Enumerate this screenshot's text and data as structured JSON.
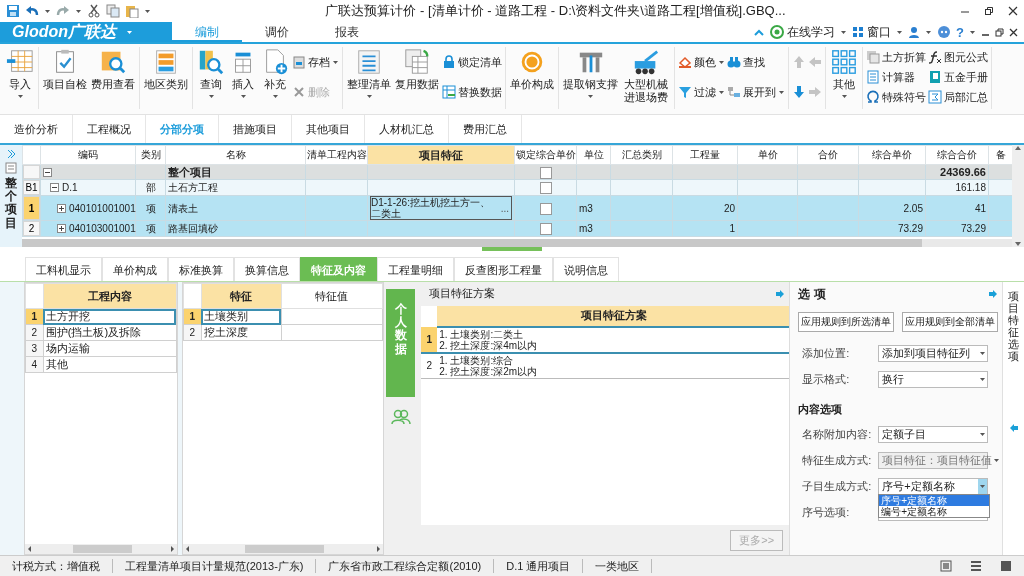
{
  "window": {
    "title": "广联达预算计价 - [清单计价 - 道路工程 - D:\\资料文件夹\\道路工程[增值税].GBQ..."
  },
  "menu": {
    "logo": "Glodon广联达",
    "tabs": [
      {
        "label": "编制",
        "selected": true
      },
      {
        "label": "调价",
        "selected": false
      },
      {
        "label": "报表",
        "selected": false
      }
    ],
    "links": [
      "在线学习",
      "窗口"
    ],
    "help": "?"
  },
  "ribbon": {
    "groups": [
      {
        "columns": [
          [
            {
              "label": "导入",
              "kind": "large",
              "dropdown": true
            }
          ]
        ]
      },
      {
        "columns": [
          [
            {
              "label": "项目自检",
              "kind": "large",
              "dropdown": false
            }
          ],
          [
            {
              "label": "费用查看",
              "kind": "large",
              "dropdown": false
            }
          ]
        ]
      },
      {
        "columns": [
          [
            {
              "label": "地区类别",
              "kind": "large",
              "dropdown": false
            }
          ]
        ]
      },
      {
        "columns": [
          [
            {
              "label": "查询",
              "kind": "large",
              "dropdown": true
            }
          ],
          [
            {
              "label": "插入",
              "kind": "large",
              "dropdown": true
            }
          ],
          [
            {
              "label": "补充",
              "kind": "large",
              "dropdown": true
            }
          ],
          [
            {
              "label": "存档",
              "kind": "small",
              "dropdown": true,
              "disabled": false
            },
            {
              "label": "删除",
              "kind": "small",
              "dropdown": false,
              "disabled": true
            }
          ]
        ]
      },
      {
        "columns": [
          [
            {
              "label": "整理清单",
              "kind": "large",
              "dropdown": true
            }
          ],
          [
            {
              "label": "复用数据",
              "kind": "large",
              "dropdown": false
            }
          ],
          [
            {
              "label": "锁定清单",
              "kind": "small",
              "dropdown": false,
              "disabled": false
            },
            {
              "label": "替换数据",
              "kind": "small",
              "dropdown": false,
              "disabled": false
            }
          ]
        ]
      },
      {
        "columns": [
          [
            {
              "label": "单价构成",
              "kind": "large",
              "dropdown": false
            }
          ]
        ]
      },
      {
        "columns": [
          [
            {
              "label": "提取钢支撑",
              "kind": "large",
              "dropdown": true
            }
          ],
          [
            {
              "label": "大型机械进退场费",
              "kind": "large",
              "dropdown": false
            }
          ]
        ]
      },
      {
        "columns": [
          [
            {
              "label": "颜色",
              "kind": "small",
              "dropdown": true,
              "disabled": false
            },
            {
              "label": "过滤",
              "kind": "small",
              "dropdown": true,
              "disabled": false
            }
          ],
          [
            {
              "label": "查找",
              "kind": "small",
              "dropdown": false,
              "disabled": false
            },
            {
              "label": "展开到",
              "kind": "small",
              "dropdown": true,
              "disabled": false
            }
          ]
        ]
      },
      {
        "columns": [
          [
            {
              "kind": "arrow",
              "disabled": true
            },
            {
              "kind": "arrow",
              "disabled": false
            }
          ],
          [
            {
              "kind": "arrow",
              "disabled": true
            },
            {
              "kind": "arrow",
              "disabled": true
            }
          ]
        ]
      },
      {
        "columns": [
          [
            {
              "label": "其他",
              "kind": "large",
              "dropdown": true
            }
          ]
        ]
      },
      {
        "columns": [
          [
            {
              "label": "土方折算",
              "kind": "small",
              "dropdown": false,
              "disabled": false
            },
            {
              "label": "计算器",
              "kind": "small",
              "dropdown": false,
              "disabled": false
            },
            {
              "label": "特殊符号",
              "kind": "small",
              "dropdown": false,
              "disabled": false
            }
          ],
          [
            {
              "label": "图元公式",
              "kind": "small",
              "dropdown": false,
              "disabled": false
            },
            {
              "label": "五金手册",
              "kind": "small",
              "dropdown": false,
              "disabled": false
            },
            {
              "label": "局部汇总",
              "kind": "small",
              "dropdown": false,
              "disabled": false
            }
          ]
        ]
      }
    ]
  },
  "nav_tabs": [
    {
      "label": "造价分析",
      "selected": false
    },
    {
      "label": "工程概况",
      "selected": false
    },
    {
      "label": "分部分项",
      "selected": true
    },
    {
      "label": "措施项目",
      "selected": false
    },
    {
      "label": "其他项目",
      "selected": false
    },
    {
      "label": "人材机汇总",
      "selected": false
    },
    {
      "label": "费用汇总",
      "selected": false
    }
  ],
  "left_strip": {
    "label": "整个项目"
  },
  "grid": {
    "columns": [
      {
        "label": "编码",
        "selected": false
      },
      {
        "label": "类别",
        "selected": false
      },
      {
        "label": "名称",
        "selected": false
      },
      {
        "label": "清单工程内容",
        "selected": false
      },
      {
        "label": "项目特征",
        "selected": true
      },
      {
        "label": "锁定综合单价",
        "selected": false
      },
      {
        "label": "单位",
        "selected": false
      },
      {
        "label": "汇总类别",
        "selected": false
      },
      {
        "label": "工程量",
        "selected": false
      },
      {
        "label": "单价",
        "selected": false
      },
      {
        "label": "合价",
        "selected": false
      },
      {
        "label": "综合单价",
        "selected": false
      },
      {
        "label": "综合合价",
        "selected": false
      },
      {
        "label": "备",
        "selected": false
      }
    ],
    "rows": [
      {
        "name": "整个项目",
        "locked": false,
        "comp_amount": "24369.66",
        "expanded": true,
        "selected": false,
        "children": [
          {
            "header": "B1",
            "code": "D.1",
            "type": "部",
            "name": "土石方工程",
            "locked": false,
            "comp_amount": "161.18",
            "expanded": true,
            "selected": false,
            "children": [
              {
                "header": "1",
                "code": "040101001001",
                "type": "项",
                "name": "清表土",
                "feature": "D1-1-26:挖土机挖土方一、二类土",
                "feature_button": "...",
                "locked": false,
                "unit": "m3",
                "qty": "20",
                "comp_price": "2.05",
                "comp_amount": "41",
                "expanded": false,
                "selected": true
              },
              {
                "header": "2",
                "code": "040103001001",
                "type": "项",
                "name": "路基回填砂",
                "locked": false,
                "unit": "m3",
                "qty": "1",
                "comp_price": "73.29",
                "comp_amount": "73.29",
                "expanded": false,
                "selected": false
              }
            ]
          }
        ]
      }
    ]
  },
  "detail_tabs": [
    {
      "label": "工料机显示",
      "selected": false
    },
    {
      "label": "单价构成",
      "selected": false
    },
    {
      "label": "标准换算",
      "selected": false
    },
    {
      "label": "换算信息",
      "selected": false
    },
    {
      "label": "特征及内容",
      "selected": true
    },
    {
      "label": "工程量明细",
      "selected": false
    },
    {
      "label": "反查图形工程量",
      "selected": false
    },
    {
      "label": "说明信息",
      "selected": false
    }
  ],
  "work_content": {
    "columns": [
      {
        "label": "工程内容",
        "selected": true
      }
    ],
    "rows": [
      {
        "num": "1",
        "text": "土方开挖",
        "selected": true
      },
      {
        "num": "2",
        "text": "围护(挡土板)及拆除",
        "selected": false
      },
      {
        "num": "3",
        "text": "场内运输",
        "selected": false
      },
      {
        "num": "4",
        "text": "其他",
        "selected": false
      }
    ]
  },
  "features": {
    "columns": [
      {
        "label": "特征",
        "selected": true
      },
      {
        "label": "特征值",
        "selected": false
      }
    ],
    "rows": [
      {
        "num": "1",
        "name": "土壤类别",
        "selected": true
      },
      {
        "num": "2",
        "name": "挖土深度",
        "selected": false
      }
    ]
  },
  "personal_data": {
    "label": "个人数据"
  },
  "scheme": {
    "title": "项目特征方案",
    "header": "项目特征方案",
    "rows": [
      {
        "num": "1",
        "lines": [
          "1. 土壤类别:二类土",
          "2. 挖土深度:深4m以内"
        ],
        "selected": true
      },
      {
        "num": "2",
        "lines": [
          "1. 土壤类别:综合",
          "2. 挖土深度:深2m以内"
        ],
        "selected": false
      }
    ],
    "more_button": {
      "label": "更多>>",
      "disabled": true
    }
  },
  "options": {
    "title": "选 项",
    "buttons": [
      "应用规则到所选清单",
      "应用规则到全部清单"
    ],
    "fields": [
      {
        "label": "添加位置:",
        "value": "添加到项目特征列",
        "disabled": false,
        "open": false
      },
      {
        "label": "显示格式:",
        "value": "换行",
        "disabled": false,
        "open": false
      }
    ],
    "section": "内容选项",
    "content_fields": [
      {
        "label": "名称附加内容:",
        "value": "定额子目",
        "disabled": false,
        "open": false
      },
      {
        "label": "特征生成方式:",
        "value": "项目特征：项目特征值",
        "disabled": true,
        "open": false
      },
      {
        "label": "子目生成方式:",
        "value": "序号+定额名称",
        "disabled": false,
        "open": true,
        "options": [
          {
            "label": "序号+定额名称",
            "selected": true
          },
          {
            "label": "编号+定额名称",
            "selected": false
          }
        ]
      },
      {
        "label": "序号选项:",
        "disabled": false,
        "open": false
      }
    ]
  },
  "side_panel": {
    "label": "项目特征选项"
  },
  "status_bar": [
    "计税方式：增值税",
    "工程量清单项目计量规范(2013-广东)",
    "广东省市政工程综合定额(2010)",
    "D.1 通用项目",
    "一类地区"
  ]
}
